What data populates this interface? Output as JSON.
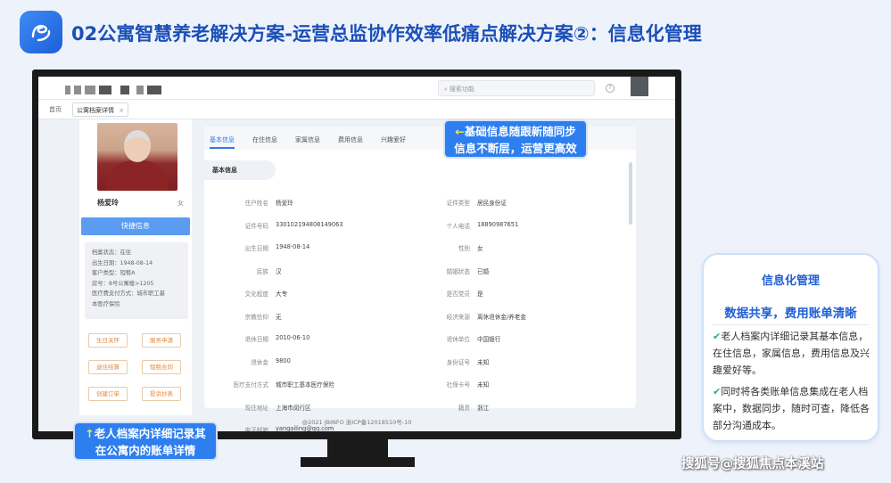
{
  "header": {
    "title": "02公寓智慧养老解决方案-运营总监协作效率低痛点解决方案②：信息化管理"
  },
  "app": {
    "search_placeholder": "搜索功能",
    "help_label": "?",
    "tabs": [
      {
        "label": "首页"
      },
      {
        "label": "公寓档案详情"
      }
    ],
    "tab_close": "×",
    "profile": {
      "name": "杨爱玲",
      "gender": "女",
      "quick_info_button": "快捷信息",
      "info_lines": [
        "档案状态：在住",
        "出生日期：1948-08-14",
        "客户类型：短租A",
        "房号：8号公寓楼>1205",
        "医疗费支付方式：城市职工基",
        "本医疗保险"
      ],
      "actions": [
        "生日关怀",
        "服务申请",
        "退住结算",
        "短租合同",
        "创建订单",
        "投诉抄表"
      ]
    },
    "detail_tabs": [
      "基本信息",
      "在住信息",
      "家属信息",
      "费用信息",
      "兴趣爱好"
    ],
    "section_title": "基本信息",
    "fields_left": [
      {
        "label": "住户姓名",
        "value": "杨爱玲"
      },
      {
        "label": "证件号码",
        "value": "330102194808149063"
      },
      {
        "label": "出生日期",
        "value": "1948-08-14"
      },
      {
        "label": "民族",
        "value": "汉"
      },
      {
        "label": "文化程度",
        "value": "大专"
      },
      {
        "label": "宗教信仰",
        "value": "无"
      },
      {
        "label": "退休日期",
        "value": "2010-06-10"
      },
      {
        "label": "退休金",
        "value": "9800"
      },
      {
        "label": "医疗支付方式",
        "value": "城市职工基本医疗保险"
      },
      {
        "label": "现住地址",
        "value": "上海市闵行区"
      },
      {
        "label": "电子邮箱",
        "value": "yangailing@qq.com"
      }
    ],
    "fields_right": [
      {
        "label": "证件类型",
        "value": "居民身份证"
      },
      {
        "label": "个人电话",
        "value": "18890987651"
      },
      {
        "label": "性别",
        "value": "女"
      },
      {
        "label": "婚姻状态",
        "value": "已婚"
      },
      {
        "label": "是否党员",
        "value": "是"
      },
      {
        "label": "经济来源",
        "value": "离休退休金/养老金"
      },
      {
        "label": "退休单位",
        "value": "中国银行"
      },
      {
        "label": "身份证号",
        "value": "未知"
      },
      {
        "label": "社保卡号",
        "value": "未知"
      },
      {
        "label": "籍贯",
        "value": "浙江"
      }
    ],
    "footer": "@2021 JBINFO 浙ICP备12018510号-10"
  },
  "callouts": {
    "top_line1": "基础信息随跟新随同步",
    "top_line2": "信息不断层，运营更高效",
    "bottom_line1": "老人档案内详细记录其",
    "bottom_line2": "在公寓内的账单详情",
    "arrow_top": "←",
    "arrow_bottom": "↑"
  },
  "card": {
    "title": "信息化管理",
    "subtitle": "数据共享，费用账单清晰",
    "check": "✔",
    "point1": "老人档案内详细记录其基本信息，在住信息，家属信息，费用信息及兴趣爱好等。",
    "point2": "同时将各类账单信息集成在老人档案中，数据同步，随时可查，降低各部分沟通成本。"
  },
  "watermark": "搜狐号@搜狐焦点本溪站",
  "colors": {
    "primary": "#2d7ff0",
    "title": "#1b4fb8",
    "accent_orange": "#e2883e",
    "check_green": "#28b463"
  }
}
